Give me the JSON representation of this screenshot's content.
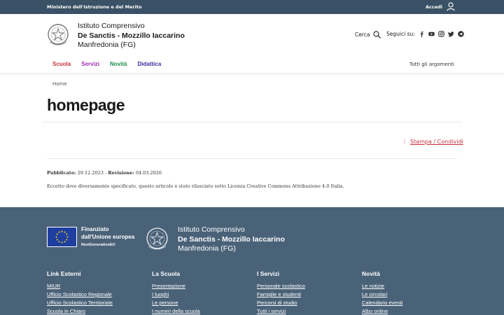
{
  "topbar": {
    "ministry": "Ministero dell'Istruzione e del Merito",
    "login": "Accedi"
  },
  "header": {
    "school_line1": "Istituto Comprensivo",
    "school_line2": "De Sanctis - Mozzillo Iaccarino",
    "school_line3": "Manfredonia (FG)",
    "search_label": "Cerca",
    "social_label": "Seguici su:"
  },
  "nav": {
    "items": [
      {
        "label": "Scuola",
        "color": "#c4303c"
      },
      {
        "label": "Servizi",
        "color": "#9b2fae"
      },
      {
        "label": "Novità",
        "color": "#1d8a4a"
      },
      {
        "label": "Didattica",
        "color": "#3a2d9a"
      }
    ],
    "all_topics": "Tutti gli argomenti"
  },
  "breadcrumb": {
    "home": "Home"
  },
  "page": {
    "title": "homepage",
    "share": "Stampa / Condividi",
    "published_label": "Pubblicato:",
    "published_date": "29.12.2023",
    "revision_label": "Revisione:",
    "revision_date": "04.03.2026",
    "license": "Eccetto dove diversamente specificato, questo articolo è stato rilasciato sotto Licenza Creative Commons Attribuzione 4.0 Italia."
  },
  "footer": {
    "eu_line1": "Finanziato",
    "eu_line2": "dall'Unione europea",
    "eu_line3": "NextGenerationEU",
    "school_line1": "Istituto Comprensivo",
    "school_line2": "De Sanctis - Mozzillo Iaccarino",
    "school_line3": "Manfredonia (FG)",
    "columns": [
      {
        "title": "Link Esterni",
        "links": [
          "MIUR",
          "Ufficio Scolastico Regionale",
          "Ufficio Scolastico Territoriale",
          "Scuola in Chiaro"
        ]
      },
      {
        "title": "La Scuola",
        "links": [
          "Presentazione",
          "I luoghi",
          "Le persone",
          "I numeri della scuola"
        ]
      },
      {
        "title": "I Servizi",
        "links": [
          "Personale scolastico",
          "Famiglie e studenti",
          "Percorsi di studio",
          "Tutti i servizi"
        ]
      },
      {
        "title": "Novità",
        "links": [
          "Le notizie",
          "Le circolari",
          "Calendario eventi",
          "Albo online"
        ]
      }
    ]
  },
  "colors": {
    "topbar": "#3a5166",
    "footer": "#4a6278",
    "accent": "#c4303c"
  }
}
